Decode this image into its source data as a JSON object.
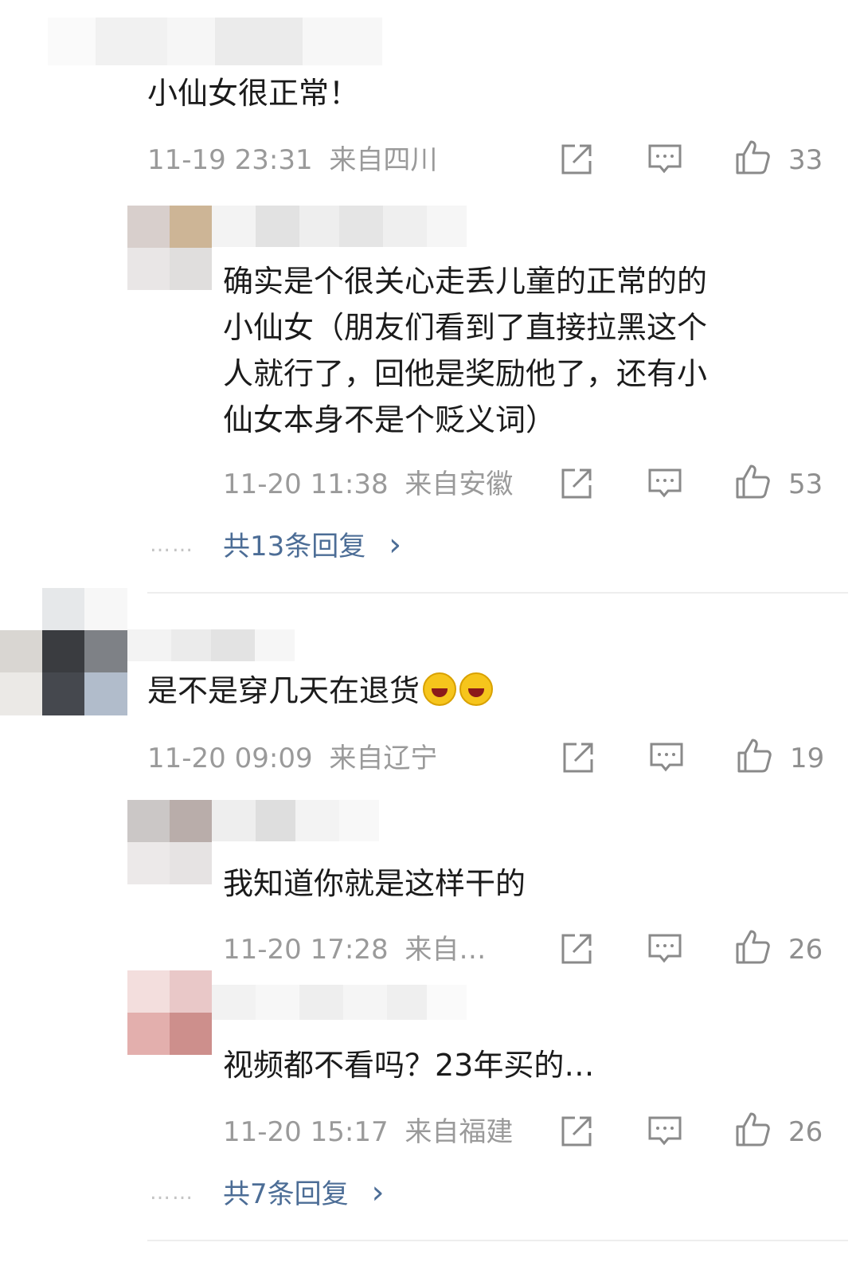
{
  "comments": [
    {
      "text": "小仙女很正常！",
      "date": "11-19 23:31",
      "location": "来自四川",
      "likes": "33",
      "replies": [
        {
          "text_lines": [
            "确实是个很关心走丢儿童的正常的的",
            "小仙女（朋友们看到了直接拉黑这个",
            "人就行了，回他是奖励他了，还有小",
            "仙女本身不是个贬义词）"
          ],
          "date": "11-20 11:38",
          "location": "来自安徽",
          "likes": "53"
        }
      ],
      "more_replies": "共13条回复"
    },
    {
      "text": "是不是穿几天在退货",
      "date": "11-20 09:09",
      "location": "来自辽宁",
      "likes": "19",
      "replies": [
        {
          "text": "我知道你就是这样干的",
          "date": "11-20 17:28",
          "location": "来自…",
          "likes": "26"
        },
        {
          "text": "视频都不看吗？23年买的…",
          "date": "11-20 15:17",
          "location": "来自福建",
          "likes": "26"
        }
      ],
      "more_replies": "共7条回复"
    }
  ],
  "ui": {
    "dots": "……",
    "chevron": "›",
    "icons": [
      "share-icon",
      "comment-icon",
      "like-icon"
    ],
    "colors": {
      "link": "#4c6d96",
      "meta": "#9a9a9a",
      "text": "#1b1b1b"
    }
  }
}
